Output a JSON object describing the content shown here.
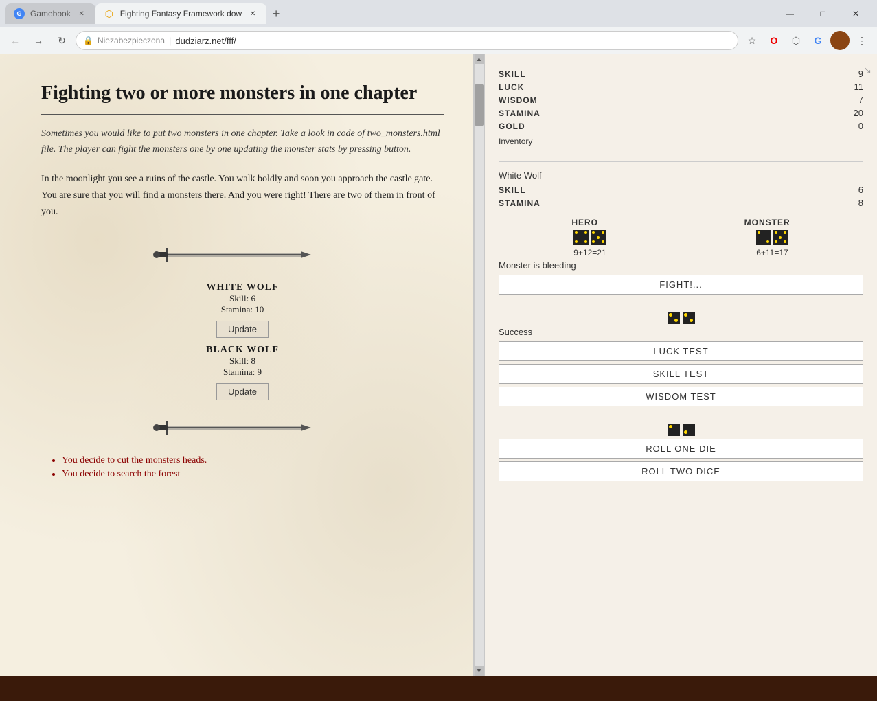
{
  "browser": {
    "tabs": [
      {
        "id": "tab1",
        "label": "Gamebook",
        "favicon": "G",
        "active": false
      },
      {
        "id": "tab2",
        "label": "Fighting Fantasy Framework dow",
        "favicon": "⬡",
        "active": true
      }
    ],
    "url": {
      "protocol": "Niezabezpieczona",
      "separator": "|",
      "address": "dudziarz.net/fff/"
    },
    "window_controls": {
      "minimize": "—",
      "maximize": "□",
      "close": "✕"
    }
  },
  "page": {
    "title": "Fighting two or more monsters in one chapter",
    "intro": "Sometimes you would like to put two monsters in one chapter. Take a look in code of two_monsters.html file. The player can fight the monsters one by one updating the monster stats by pressing button.",
    "body_text": "In the moonlight you see a ruins of the castle. You walk boldly and soon you approach the castle gate. You are sure that you will find a monsters there. And you were right! There are two of them in front of you.",
    "monsters": [
      {
        "name": "WHITE WOLF",
        "skill": "Skill: 6",
        "stamina": "Stamina: 10",
        "update_btn": "Update"
      },
      {
        "name": "BLACK WOLF",
        "skill": "Skill: 8",
        "stamina": "Stamina: 9",
        "update_btn": "Update"
      }
    ],
    "choices": [
      "You decide to cut the monsters heads.",
      "You decide to search the forest"
    ]
  },
  "stats": {
    "attributes": [
      {
        "label": "SKILL",
        "value": "9"
      },
      {
        "label": "LUCK",
        "value": "11"
      },
      {
        "label": "WISDOM",
        "value": "7"
      },
      {
        "label": "STAMINA",
        "value": "20"
      },
      {
        "label": "GOLD",
        "value": "0"
      }
    ],
    "inventory_label": "Inventory",
    "monster": {
      "name": "White Wolf",
      "skill_label": "SKILL",
      "skill_value": "6",
      "stamina_label": "STAMINA",
      "stamina_value": "8"
    }
  },
  "combat": {
    "hero_label": "HERO",
    "monster_label": "MONSTER",
    "hero_score": "9+12=21",
    "monster_score": "6+11=17",
    "status": "Monster is bleeding",
    "fight_btn": "FIGHT!...",
    "test_buttons": [
      "LUCK TEST",
      "SKILL TEST",
      "WISDOM TEST"
    ],
    "success_label": "Success",
    "roll_one_die_btn": "ROLL ONE DIE",
    "roll_two_dice_btn": "ROLL TWO DICE"
  },
  "dice": {
    "hero_dice": [
      [
        0,
        1,
        0,
        1,
        0,
        1,
        0,
        1,
        0
      ],
      [
        1,
        0,
        1,
        0,
        1,
        0,
        1,
        0,
        1
      ]
    ],
    "monster_dice": [
      [
        1,
        0,
        0,
        0,
        0,
        0,
        0,
        0,
        1
      ],
      [
        1,
        0,
        1,
        0,
        1,
        0,
        1,
        0,
        1
      ]
    ],
    "small_dice_1": [
      1,
      0,
      0,
      1
    ],
    "small_dice_2": [
      1,
      0,
      0,
      1
    ],
    "roll_dice_1": [
      1,
      0,
      0,
      0
    ],
    "roll_dice_2": [
      0,
      0,
      1,
      0
    ]
  }
}
